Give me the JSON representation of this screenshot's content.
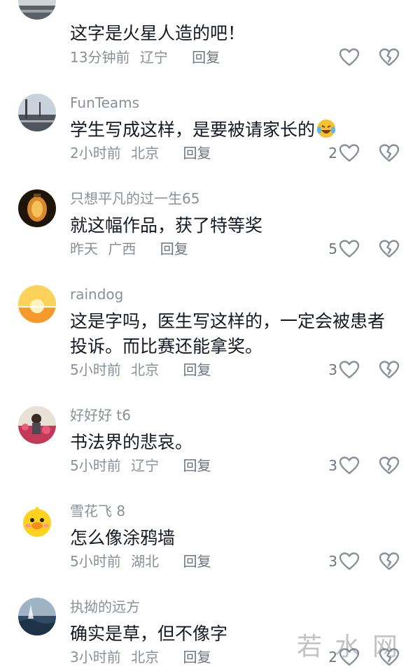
{
  "heart_color": "#8a8f99",
  "comments": [
    {
      "username": "",
      "text": "这字是火星人造的吧！",
      "time": "13分钟前",
      "location": "辽宁",
      "reply": "回复",
      "likes": "",
      "avatar": "road-photo-avatar"
    },
    {
      "username": "FunTeams",
      "text": "学生写成这样，是要被请家长的",
      "emoji": "laughing-crying-emoji",
      "time": "2小时前",
      "location": "北京",
      "reply": "回复",
      "likes": "2",
      "avatar": "road-photo-avatar"
    },
    {
      "username": "只想平凡的过一生65",
      "text": "就这幅作品，获了特等奖",
      "time": "昨天",
      "location": "广西",
      "reply": "回复",
      "likes": "5",
      "avatar": "lantern-avatar"
    },
    {
      "username": "raindog",
      "text": "这是字吗，医生写这样的，一定会被患者投诉。而比赛还能拿奖。",
      "time": "5小时前",
      "location": "北京",
      "reply": "回复",
      "likes": "3",
      "avatar": "sunset-avatar"
    },
    {
      "username": "好好好 t6",
      "text": "书法界的悲哀。",
      "time": "5小时前",
      "location": "辽宁",
      "reply": "回复",
      "likes": "3",
      "avatar": "flowers-avatar"
    },
    {
      "username": "雪花飞 8",
      "text": "怎么像涂鸦墙",
      "time": "5小时前",
      "location": "湖北",
      "reply": "回复",
      "likes": "3",
      "avatar": "duck-avatar"
    },
    {
      "username": "执拗的远方",
      "text": "确实是草，但不像字",
      "time": "3小时前",
      "location": "北京",
      "reply": "回复",
      "likes": "2",
      "avatar": "sea-avatar"
    }
  ],
  "watermark": "若水网"
}
